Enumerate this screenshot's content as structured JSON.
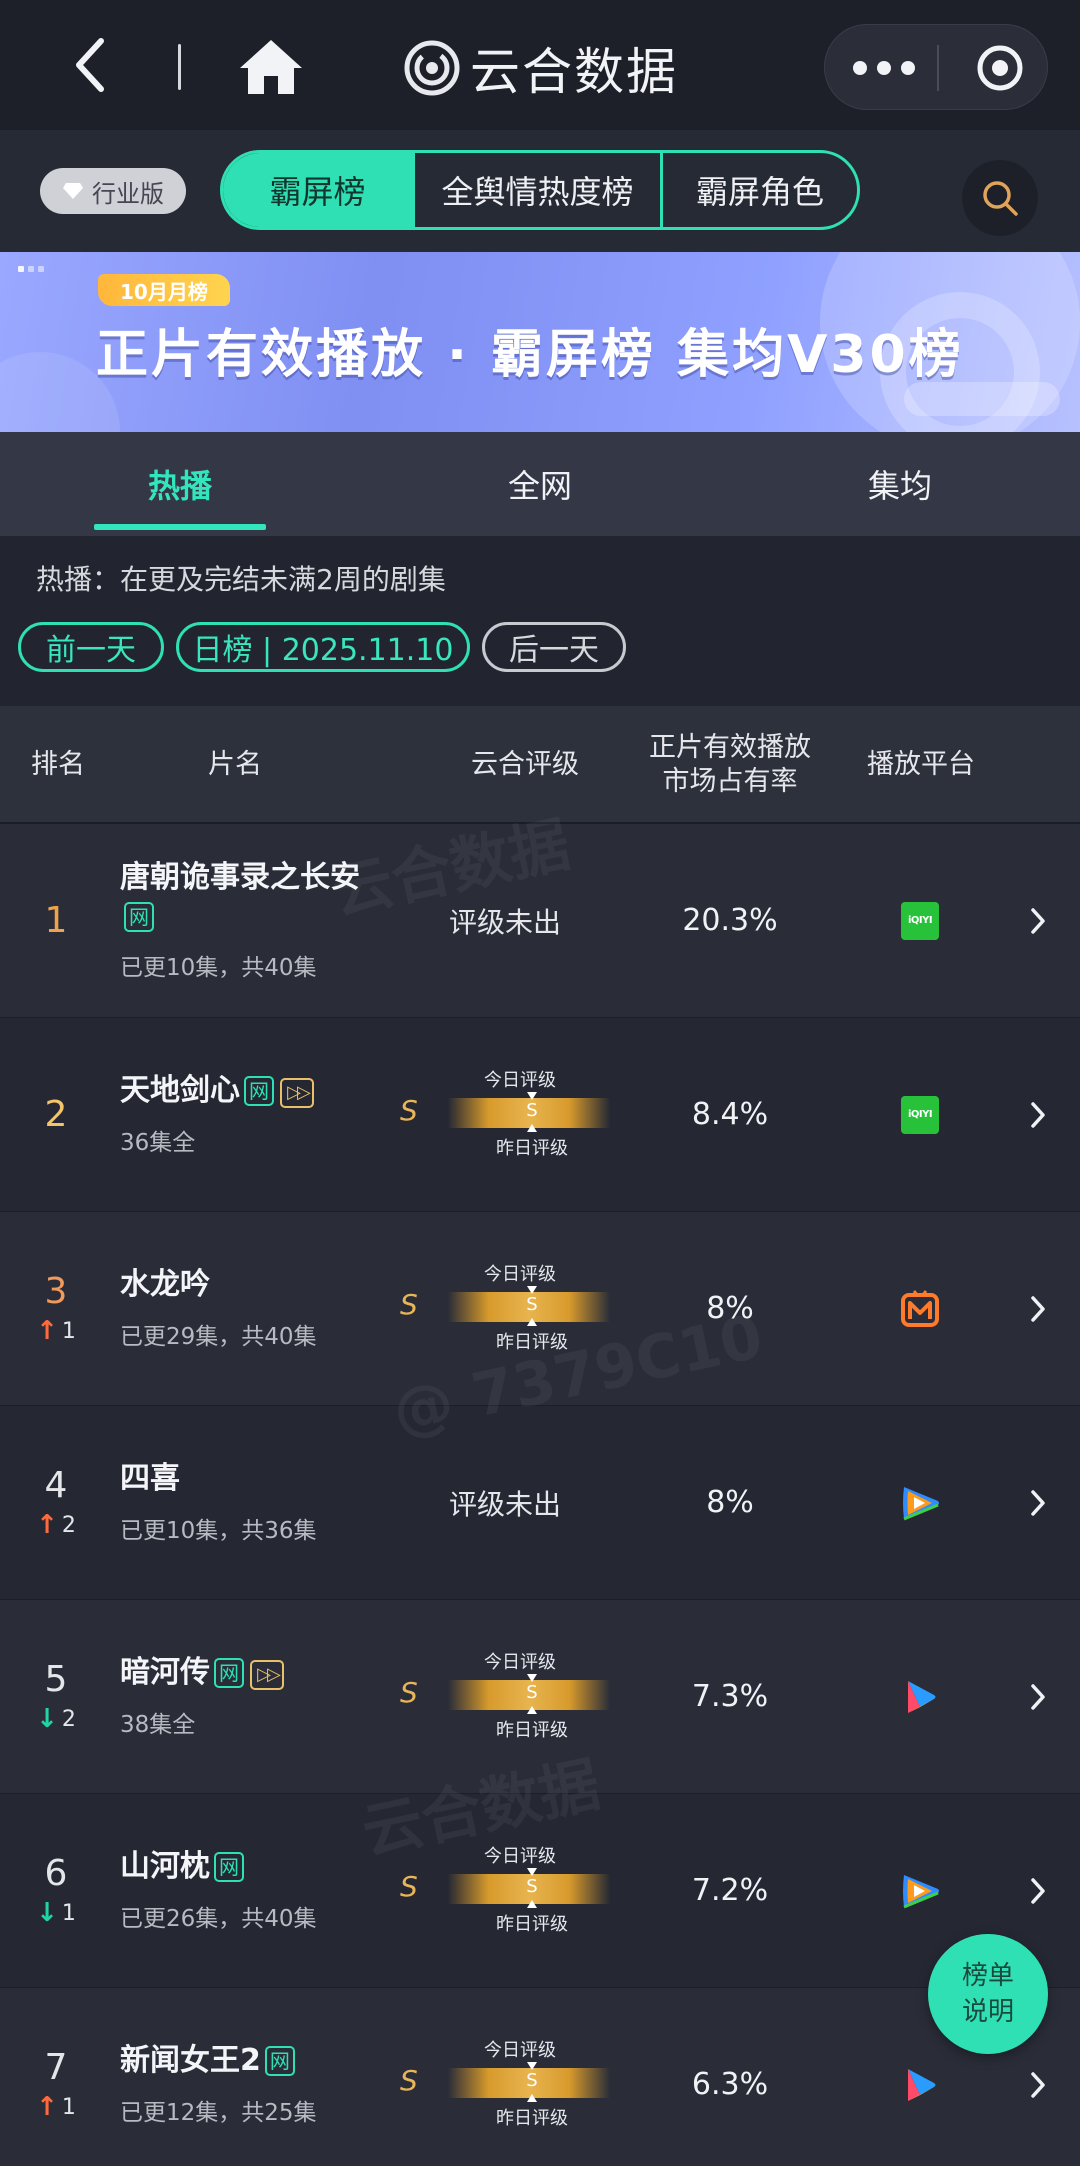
{
  "app": {
    "title": "云合数据"
  },
  "tabbar": {
    "badge": "行业版",
    "segments": [
      "霸屏榜",
      "全舆情热度榜",
      "霸屏角色"
    ],
    "active": 0
  },
  "banner": {
    "month_tag": "10月月榜",
    "headline": "正片有效播放 · 霸屏榜 集均V30榜"
  },
  "subtabs": [
    "热播",
    "全网",
    "集均"
  ],
  "info": {
    "desc": "热播：在更及完结未满2周的剧集",
    "prev_day": "前一天",
    "date_chip": "日榜 | 2025.11.10",
    "next_day": "后一天"
  },
  "table": {
    "headers": {
      "rank": "排名",
      "title": "片名",
      "rating": "云合评级",
      "share": "正片有效播放\n市场占有率",
      "platform": "播放平台"
    },
    "rating_labels": {
      "today": "今日评级",
      "yesterday": "昨日评级",
      "grade": "S",
      "na": "评级未出"
    },
    "rows": [
      {
        "rank": "1",
        "change": "",
        "title": "唐朝诡事录之长安",
        "net_tag": "网",
        "play_tag": false,
        "sub": "已更10集，共40集",
        "rated": false,
        "share": "20.3%",
        "platform": "iqiyi"
      },
      {
        "rank": "2",
        "change": "",
        "title": "天地剑心",
        "net_tag": "网",
        "play_tag": true,
        "sub": "36集全",
        "rated": true,
        "share": "8.4%",
        "platform": "iqiyi"
      },
      {
        "rank": "3",
        "change": "1",
        "dir": "up",
        "title": "水龙吟",
        "net_tag": "",
        "play_tag": false,
        "sub": "已更29集，共40集",
        "rated": true,
        "share": "8%",
        "platform": "mango"
      },
      {
        "rank": "4",
        "change": "2",
        "dir": "up",
        "title": "四喜",
        "net_tag": "",
        "play_tag": false,
        "sub": "已更10集，共36集",
        "rated": false,
        "share": "8%",
        "platform": "tencent"
      },
      {
        "rank": "5",
        "change": "2",
        "dir": "down",
        "title": "暗河传",
        "net_tag": "网",
        "play_tag": true,
        "sub": "38集全",
        "rated": true,
        "share": "7.3%",
        "platform": "youku"
      },
      {
        "rank": "6",
        "change": "1",
        "dir": "down",
        "title": "山河枕",
        "net_tag": "网",
        "play_tag": false,
        "sub": "已更26集，共40集",
        "rated": true,
        "share": "7.2%",
        "platform": "tencent"
      },
      {
        "rank": "7",
        "change": "1",
        "dir": "up",
        "title": "新闻女王2",
        "net_tag": "网",
        "play_tag": false,
        "sub": "已更12集，共25集",
        "rated": true,
        "share": "6.3%",
        "platform": "youku"
      }
    ]
  },
  "float_button": {
    "line1": "榜单",
    "line2": "说明"
  },
  "colors": {
    "accent": "#2ee0b4",
    "background": "#22252f",
    "gold": "#e8b44f",
    "up": "#ff6a3d",
    "down": "#20d4a6"
  }
}
